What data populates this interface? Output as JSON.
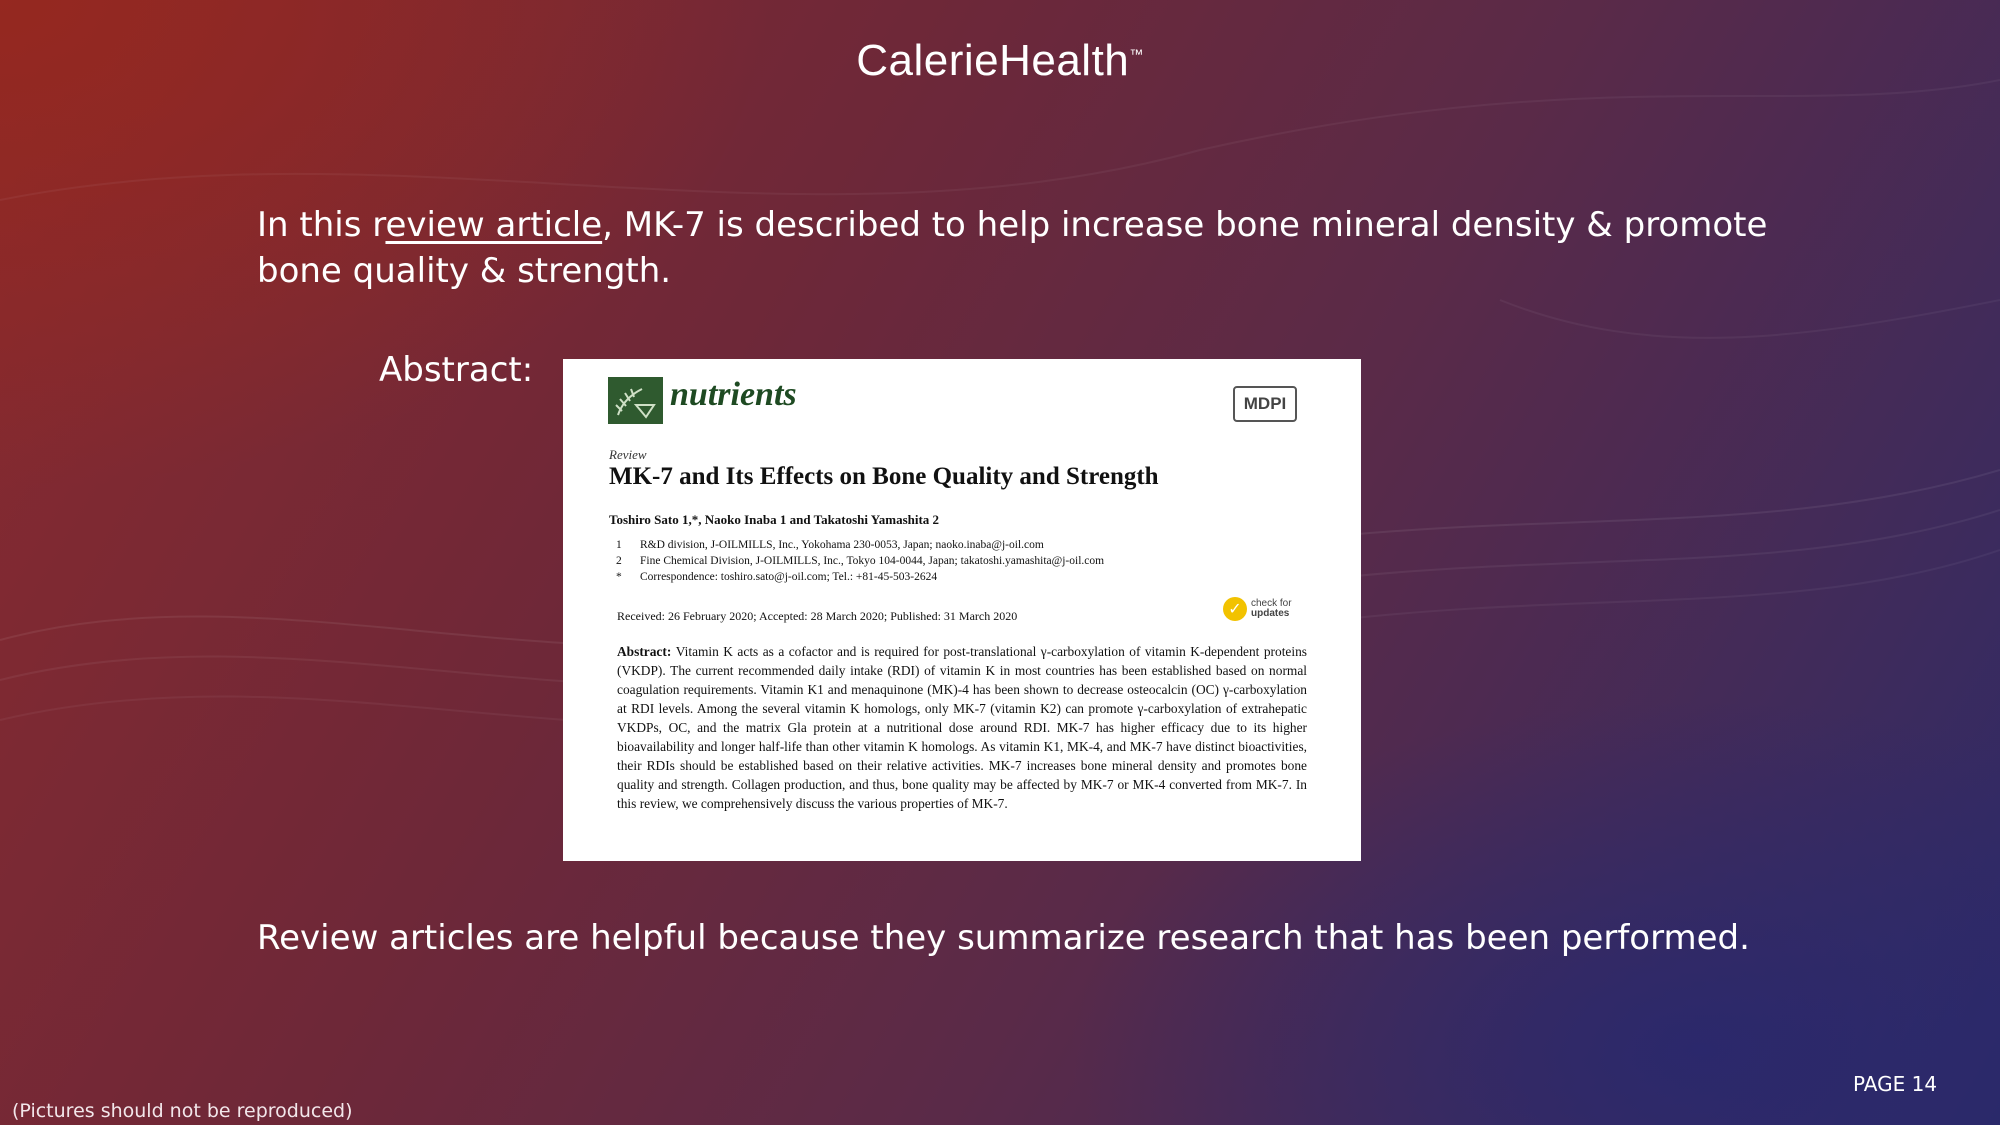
{
  "brand": {
    "name": "CalerieHealth",
    "trademark": "™"
  },
  "lead": {
    "pre": "In this r",
    "link_text": "eview article",
    "post": ", MK-7 is described to help increase bone mineral density & promote bone quality & strength."
  },
  "abstract_label": "Abstract:",
  "paper": {
    "journal": "nutrients",
    "publisher": "MDPI",
    "type": "Review",
    "title": "MK-7 and Its Effects on Bone Quality and Strength",
    "authors": "Toshiro Sato 1,*, Naoko Inaba 1 and Takatoshi Yamashita 2",
    "affiliations": [
      {
        "mark": "1",
        "text": "R&D division, J-OILMILLS, Inc., Yokohama 230-0053, Japan; naoko.inaba@j-oil.com"
      },
      {
        "mark": "2",
        "text": "Fine Chemical Division, J-OILMILLS, Inc., Tokyo 104-0044, Japan; takatoshi.yamashita@j-oil.com"
      },
      {
        "mark": "*",
        "text": "Correspondence: toshiro.sato@j-oil.com; Tel.: +81-45-503-2624"
      }
    ],
    "dates": "Received: 26 February 2020; Accepted: 28 March 2020; Published: 31 March 2020",
    "check_updates": {
      "line1": "check for",
      "line2": "updates"
    },
    "abstract_heading": "Abstract:",
    "abstract_text": "Vitamin K acts as a cofactor and is required for post-translational γ-carboxylation of vitamin K-dependent proteins (VKDP). The current recommended daily intake (RDI) of vitamin K in most countries has been established based on normal coagulation requirements. Vitamin K1 and menaquinone (MK)-4 has been shown to decrease osteocalcin (OC) γ-carboxylation at RDI levels. Among the several vitamin K homologs, only MK-7 (vitamin K2) can promote γ-carboxylation of extrahepatic VKDPs, OC, and the matrix Gla protein at a nutritional dose around RDI. MK-7 has higher efficacy due to its higher bioavailability and longer half-life than other vitamin K homologs. As vitamin K1, MK-4, and MK-7 have distinct bioactivities, their RDIs should be established based on their relative activities. MK-7 increases bone mineral density and promotes bone quality and strength. Collagen production, and thus, bone quality may be affected by MK-7 or MK-4 converted from MK-7. In this review, we comprehensively discuss the various properties of MK-7."
  },
  "closing": "Review articles are helpful because they summarize research that has been performed.",
  "page_number": "PAGE 14",
  "note": "(Pictures should not be reproduced)"
}
